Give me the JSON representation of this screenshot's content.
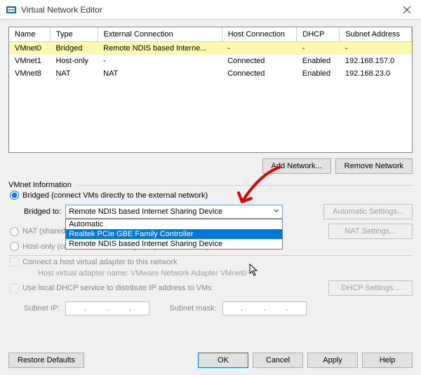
{
  "window": {
    "title": "Virtual Network Editor",
    "close_icon": "×"
  },
  "table": {
    "headers": [
      "Name",
      "Type",
      "External Connection",
      "Host Connection",
      "DHCP",
      "Subnet Address"
    ],
    "rows": [
      {
        "name": "VMnet0",
        "type": "Bridged",
        "ext": "Remote NDIS based Interne...",
        "host": "-",
        "dhcp": "-",
        "subnet": "-",
        "selected": true
      },
      {
        "name": "VMnet1",
        "type": "Host-only",
        "ext": "-",
        "host": "Connected",
        "dhcp": "Enabled",
        "subnet": "192.168.157.0"
      },
      {
        "name": "VMnet8",
        "type": "NAT",
        "ext": "NAT",
        "host": "Connected",
        "dhcp": "Enabled",
        "subnet": "192.168.23.0"
      }
    ]
  },
  "buttons": {
    "add_network": "Add Network...",
    "remove_network": "Remove Network",
    "automatic_settings": "Automatic Settings...",
    "nat_settings": "NAT Settings...",
    "dhcp_settings": "DHCP Settings...",
    "restore_defaults": "Restore Defaults",
    "ok": "OK",
    "cancel": "Cancel",
    "apply": "Apply",
    "help": "Help"
  },
  "vmnet_info": {
    "legend": "VMnet Information",
    "bridged_radio": "Bridged (connect VMs directly to the external network)",
    "bridged_to_label": "Bridged to:",
    "dropdown_selected": "Remote NDIS based Internet Sharing Device",
    "dropdown_options": [
      "Automatic",
      "Realtek PCIe GBE Family Controller",
      "Remote NDIS based Internet Sharing Device"
    ],
    "dropdown_highlight_index": 1,
    "nat_radio": "NAT (shared ",
    "hostonly_radio": "Host-only (connect VMs internally in a private network)",
    "connect_host_adapter": "Connect a host virtual adapter to this network",
    "host_adapter_name": "Host virtual adapter name: VMware Network Adapter VMnet0",
    "use_dhcp": "Use local DHCP service to distribute IP address to VMs",
    "subnet_ip_label": "Subnet IP:",
    "subnet_mask_label": "Subnet mask:"
  }
}
